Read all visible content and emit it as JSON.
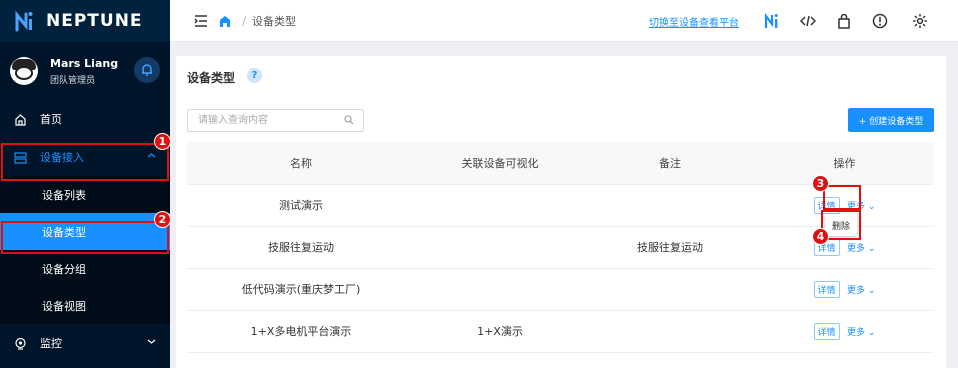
{
  "app": {
    "name": "NEPTUNE"
  },
  "user": {
    "name": "Mars Liang",
    "role": "团队管理员"
  },
  "sidebar": {
    "items": [
      {
        "label": "首页"
      },
      {
        "label": "设备接入"
      },
      {
        "label": "监控"
      }
    ],
    "sub_items": [
      {
        "label": "设备列表"
      },
      {
        "label": "设备类型"
      },
      {
        "label": "设备分组"
      },
      {
        "label": "设备视图"
      }
    ]
  },
  "header": {
    "breadcrumb_sep": "/",
    "breadcrumb": "设备类型",
    "switch_link": "切换至设备查看平台"
  },
  "main": {
    "title": "设备类型",
    "help": "?",
    "search_placeholder": "请输入查询内容",
    "create_button": "+ 创建设备类型",
    "columns": [
      "名称",
      "关联设备可视化",
      "备注",
      "操作"
    ],
    "rows": [
      {
        "name": "测试演示",
        "visual": "",
        "note": ""
      },
      {
        "name": "技服往复运动",
        "visual": "",
        "note": "技服往复运动"
      },
      {
        "name": "低代码演示(重庆梦工厂)",
        "visual": "",
        "note": ""
      },
      {
        "name": "1+X多电机平台演示",
        "visual": "1+X演示",
        "note": ""
      }
    ],
    "detail_label": "详情",
    "more_label": "更多",
    "dropdown_delete": "删除"
  },
  "annotations": [
    "1",
    "2",
    "3",
    "4"
  ],
  "colors": {
    "primary": "#1890ff",
    "sidebar": "#001529",
    "annotation": "#e01010"
  }
}
